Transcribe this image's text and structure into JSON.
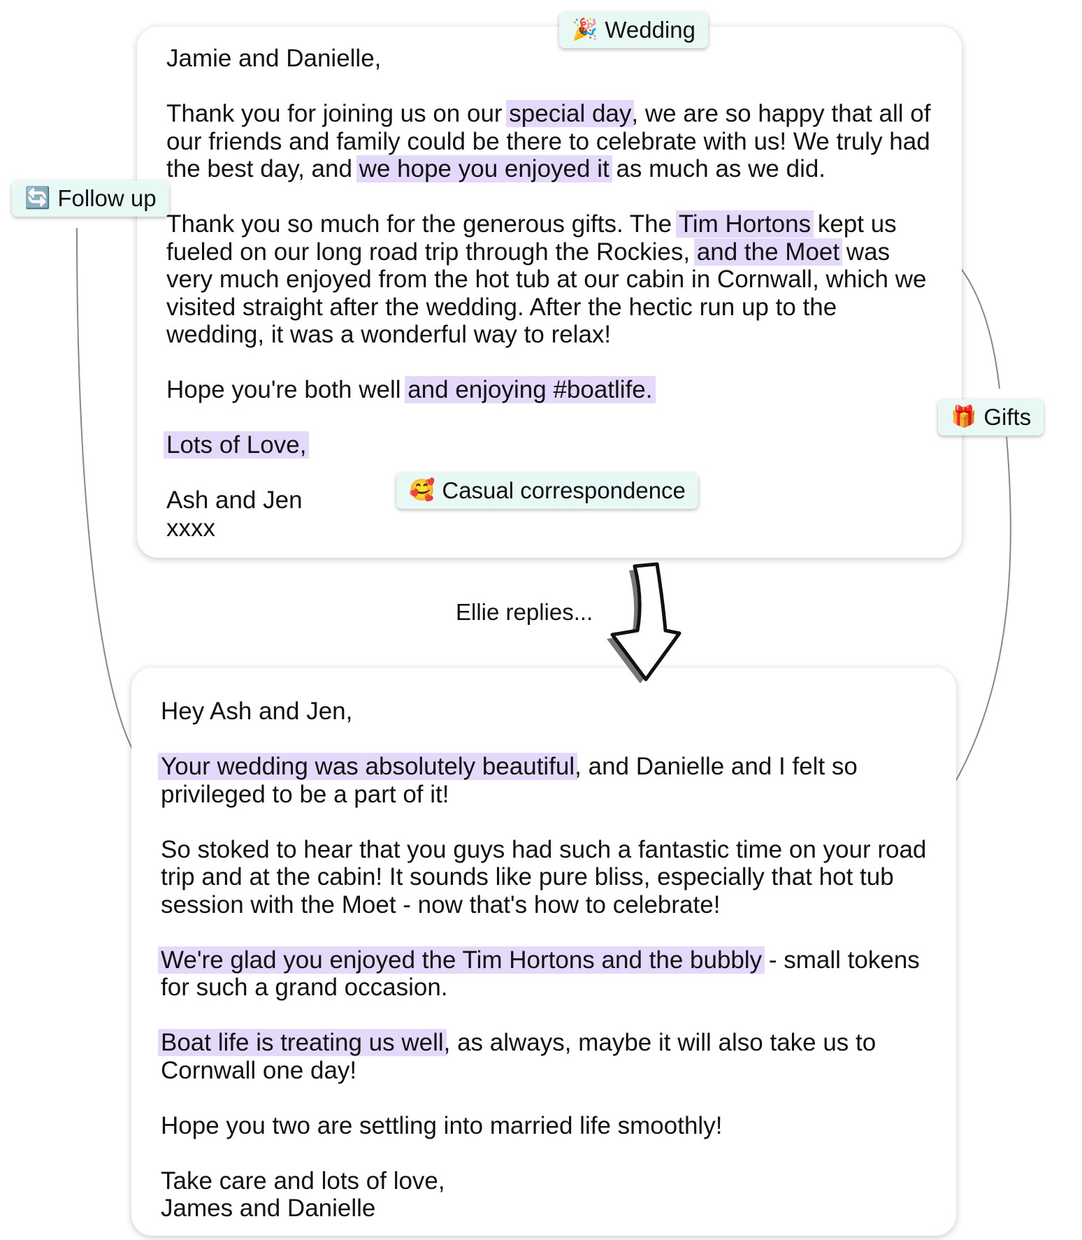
{
  "tags": {
    "wedding": {
      "icon": "party-popper-icon",
      "glyph": "🎉",
      "label": "Wedding"
    },
    "follow_up": {
      "icon": "refresh-icon",
      "glyph": "🔄",
      "label": "Follow up"
    },
    "gifts": {
      "icon": "gift-icon",
      "glyph": "🎁",
      "label": "Gifts"
    },
    "casual": {
      "icon": "smiling-face-with-hearts-icon",
      "glyph": "🥰",
      "label": "Casual correspondence"
    }
  },
  "caption": "Ellie replies...",
  "colors": {
    "highlight": "#e4d9fb",
    "tag_background": "#e8f8f5",
    "connector": "#888888"
  },
  "letter_top": {
    "greeting": "Jamie and Danielle,",
    "p1": {
      "a": "Thank you for joining us on our ",
      "hl1": "special day",
      "b": ", we are so happy that all of our friends and family could be there to celebrate with us! We truly had the best day, and ",
      "hl2": "we hope you enjoyed it",
      "c": " as much as we did."
    },
    "p2": {
      "a": "Thank you so much for the generous gifts. The ",
      "hl1": "Tim Hortons",
      "b": " kept us fueled on our long road trip through the Rockies, ",
      "hl2": "and the Moet",
      "c": " was very much enjoyed from the hot tub at our cabin in Cornwall, which we visited straight after the wedding. After the hectic run up to the wedding, it was a wonderful way to relax!"
    },
    "p3": {
      "a": "Hope you're both well ",
      "hl1": "and enjoying #boatlife."
    },
    "signoff": "Lots of Love,",
    "names": "Ash and Jen",
    "kisses": "xxxx"
  },
  "letter_bottom": {
    "greeting": "Hey Ash and Jen,",
    "p1": {
      "hl1": "Your wedding was absolutely beautiful",
      "a": ", and Danielle and I felt so privileged to be a part of it!"
    },
    "p2": "So stoked to hear that you guys had such a fantastic time on your road trip and at the cabin! It sounds like pure bliss, especially that hot tub session with the Moet - now that's how to celebrate!",
    "p3": {
      "hl1": "We're glad you enjoyed the Tim Hortons and the bubbly",
      "a": " - small tokens for such a grand occasion."
    },
    "p4": {
      "hl1": "Boat life is treating us well",
      "a": ", as always, maybe it will also take us to Cornwall one day!"
    },
    "p5": "Hope you two are settling into married life smoothly!",
    "signoff": "Take care and lots of love,",
    "names": "James and Danielle"
  }
}
